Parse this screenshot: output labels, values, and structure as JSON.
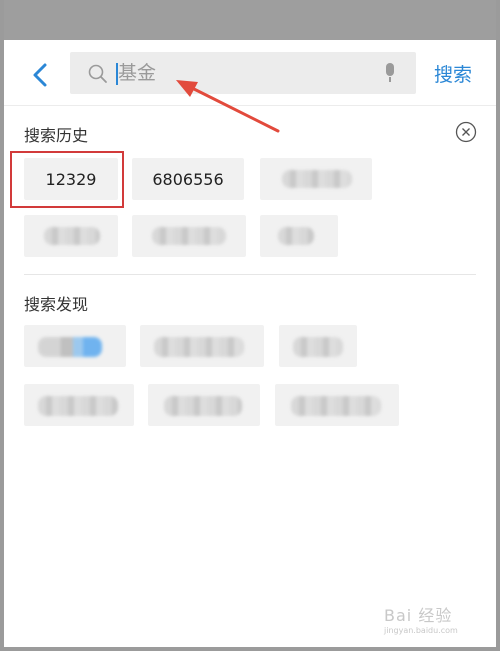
{
  "search": {
    "query": "基金",
    "button_label": "搜索"
  },
  "history": {
    "title": "搜索历史",
    "items": [
      "12329",
      "6806556"
    ]
  },
  "discover": {
    "title": "搜索发现"
  },
  "watermark": {
    "title": "Bai 经验",
    "url": "jingyan.baidu.com"
  },
  "colors": {
    "accent": "#2b87d6",
    "status_bar": "#9e9e9e",
    "highlight": "#d23a3a"
  }
}
